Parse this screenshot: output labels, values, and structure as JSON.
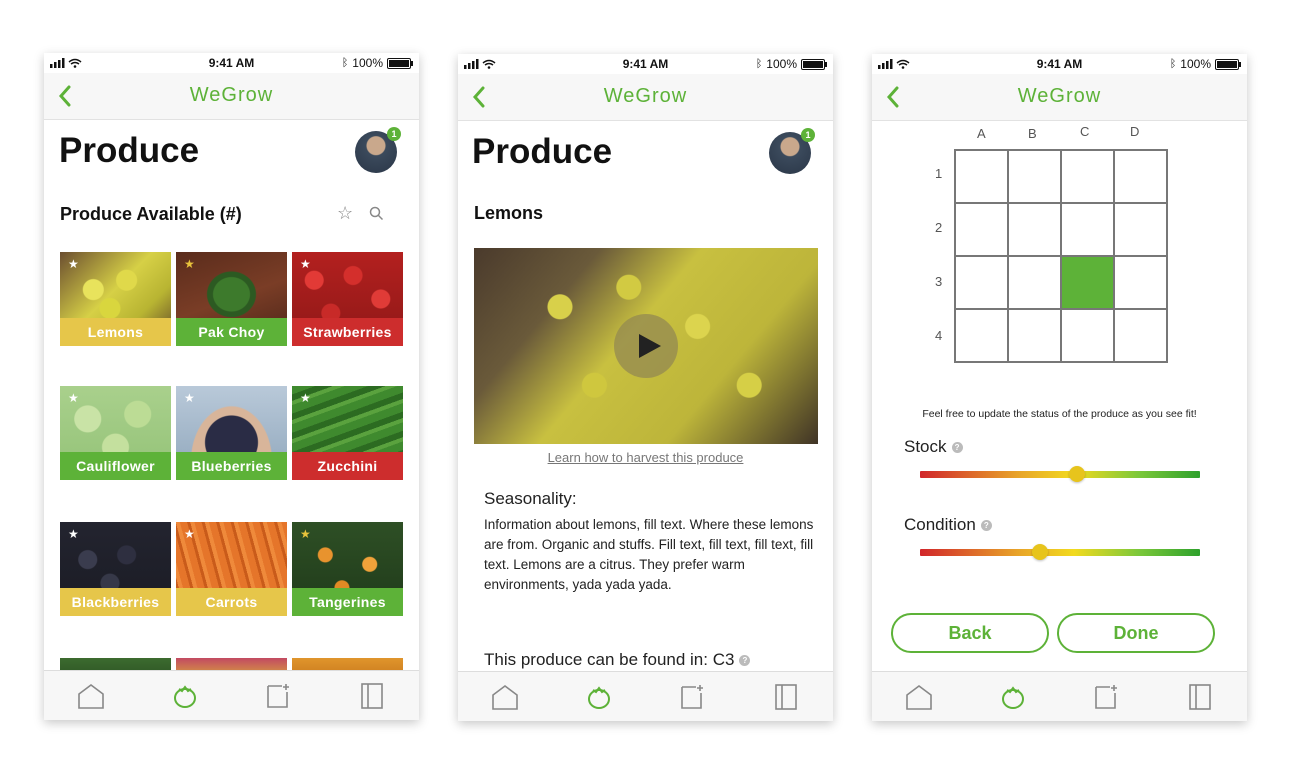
{
  "status": {
    "time": "9:41 AM",
    "battery": "100%"
  },
  "app": {
    "brand": "WeGrow"
  },
  "screen1": {
    "title": "Produce",
    "avatar_badge": "1",
    "section_title": "Produce Available (#)",
    "tiles": [
      {
        "label": "Lemons",
        "color": "yellow",
        "star": "white"
      },
      {
        "label": "Pak Choy",
        "color": "green",
        "star": "gold"
      },
      {
        "label": "Strawberries",
        "color": "red",
        "star": "white"
      },
      {
        "label": "Cauliflower",
        "color": "green",
        "star": "white"
      },
      {
        "label": "Blueberries",
        "color": "green",
        "star": "white"
      },
      {
        "label": "Zucchini",
        "color": "red",
        "star": "white"
      },
      {
        "label": "Blackberries",
        "color": "yellow",
        "star": "white"
      },
      {
        "label": "Carrots",
        "color": "yellow",
        "star": "white"
      },
      {
        "label": "Tangerines",
        "color": "green",
        "star": "gold"
      }
    ]
  },
  "screen2": {
    "title": "Produce",
    "avatar_badge": "1",
    "subtitle": "Lemons",
    "video_link": "Learn how to harvest this produce",
    "seasonality_heading": "Seasonality:",
    "seasonality_text": "Information about lemons, fill text.  Where these lemons are from.  Organic and stuffs. Fill text, fill text, fill text, fill text.  Lemons are a citrus. They prefer warm environments, yada yada yada.",
    "location_text": "This produce can be found in: C3"
  },
  "screen3": {
    "columns": [
      "A",
      "B",
      "C",
      "D"
    ],
    "rows": [
      "1",
      "2",
      "3",
      "4"
    ],
    "selected_cell": "C3",
    "note": "Feel free to update the status of the produce as you see fit!",
    "stock_label": "Stock",
    "stock_level": 0.56,
    "condition_label": "Condition",
    "condition_level": 0.43,
    "back_label": "Back",
    "done_label": "Done"
  },
  "tabs": [
    "home-icon",
    "produce-icon",
    "add-note-icon",
    "book-icon"
  ],
  "colors": {
    "brand_green": "#5db238",
    "yellow": "#e6c64a",
    "red": "#cd2d2d"
  }
}
